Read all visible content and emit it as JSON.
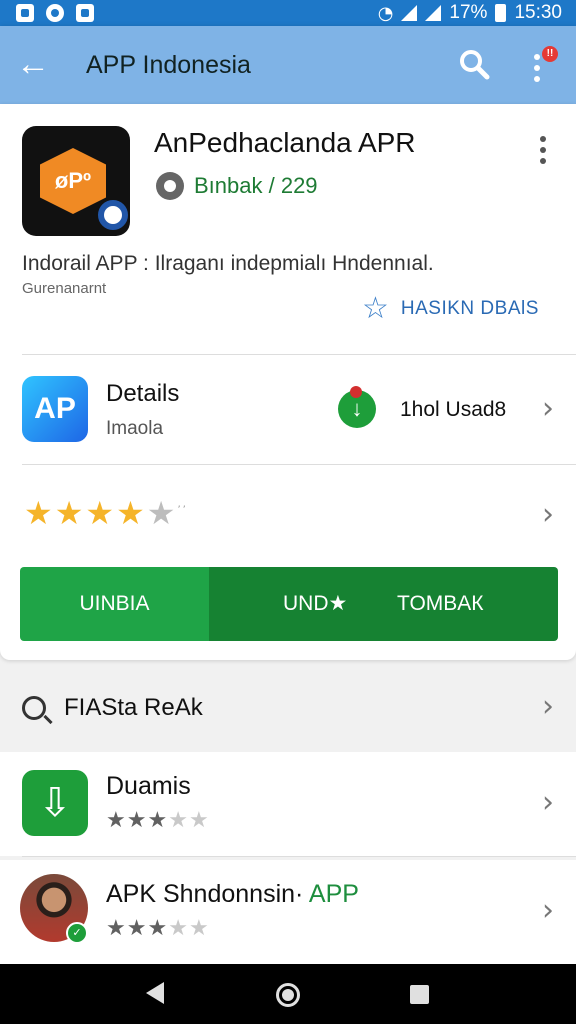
{
  "status_bar": {
    "battery": "17%",
    "time": "15:30"
  },
  "app_bar": {
    "title": "APP Indonesia",
    "notification_badge": "!!"
  },
  "app": {
    "icon_text": "øPº",
    "name": "AnPedhaclanda APR",
    "developer": "Bınbak / 229",
    "description": "Indorail APP : Ilraganı indepmialı Hndennıal.",
    "sub_description": "Gurenanarnt",
    "wishlist_label": "HASIKN DBAlS"
  },
  "details": {
    "icon_text": "AP",
    "title": "Details",
    "subtitle": "Imaola",
    "count": "1hol Usad8"
  },
  "rating": {
    "stars": 4,
    "max": 5,
    "note": "’’"
  },
  "install_bar": {
    "left_label": "UINBIA",
    "middle_label": "UND★",
    "right_label": "TOMBAК"
  },
  "related": {
    "title": "FIASta ReAk",
    "items": [
      {
        "title": "Duamis",
        "accent": "",
        "stars": 3,
        "max": 5
      },
      {
        "title": "APK Shndonnsin· ",
        "accent": "APP",
        "stars": 3,
        "max": 5
      }
    ]
  },
  "colors": {
    "status_bar": "#1e78c8",
    "app_bar": "#7fb3e6",
    "install_primary": "#1fa447",
    "install_dark": "#168232",
    "star_gold": "#f5b42a",
    "link_blue": "#2a6ab4"
  }
}
